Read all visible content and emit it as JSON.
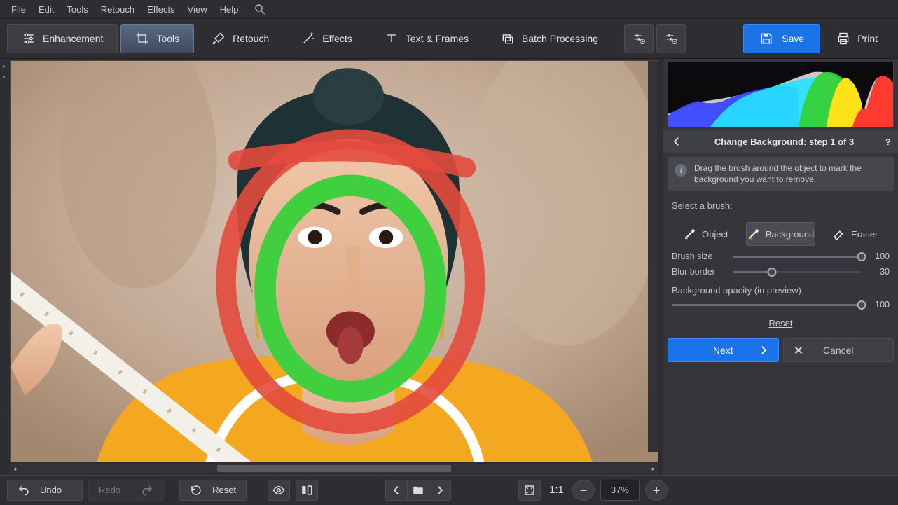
{
  "menu": [
    "File",
    "Edit",
    "Tools",
    "Retouch",
    "Effects",
    "View",
    "Help"
  ],
  "tabs": {
    "enhancement": "Enhancement",
    "tools": "Tools",
    "retouch": "Retouch",
    "effects": "Effects",
    "text_frames": "Text & Frames",
    "batch": "Batch Processing"
  },
  "toolbar": {
    "save": "Save",
    "print": "Print"
  },
  "panel": {
    "title": "Change Background: step 1 of 3",
    "info": "Drag the brush around the object to mark the background you want to remove.",
    "select_brush": "Select a brush:",
    "object": "Object",
    "background": "Background",
    "eraser": "Eraser",
    "brush_size_label": "Brush size",
    "brush_size_value": "100",
    "blur_border_label": "Blur border",
    "blur_border_value": "30",
    "bg_opacity_label": "Background opacity (in preview)",
    "bg_opacity_value": "100",
    "reset": "Reset",
    "next": "Next",
    "cancel": "Cancel"
  },
  "bottom": {
    "undo": "Undo",
    "redo": "Redo",
    "reset": "Reset",
    "ratio": "1:1",
    "zoom": "37%"
  }
}
